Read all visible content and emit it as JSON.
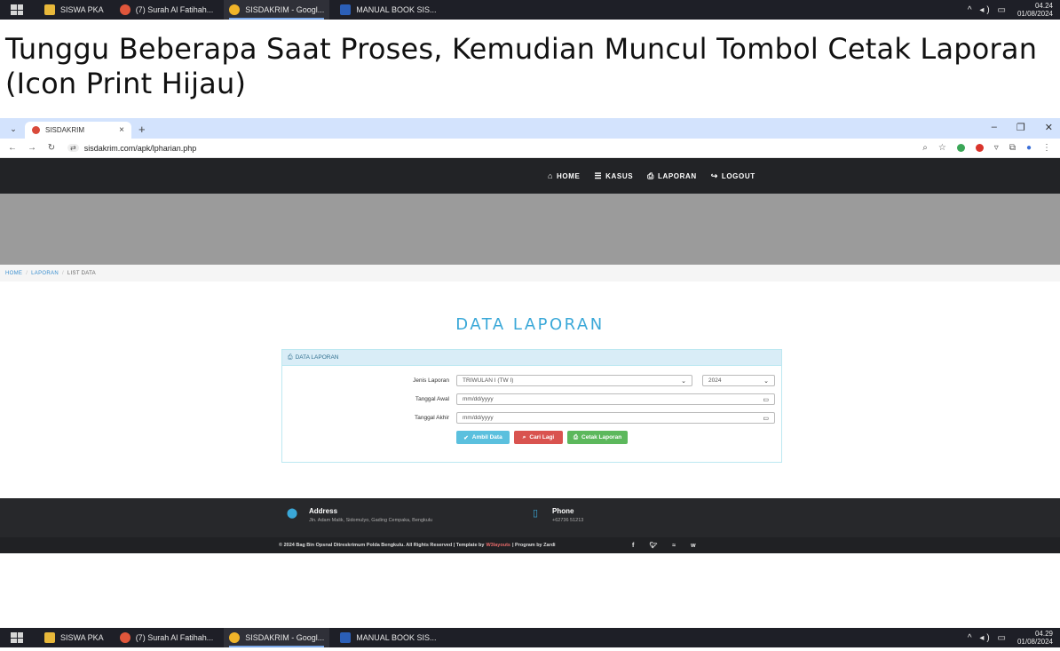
{
  "taskbar_top": {
    "items": [
      "SISWA PKA",
      "(7) Surah Al Fatihah...",
      "SISDAKRIM - Googl...",
      "MANUAL BOOK SIS..."
    ],
    "time": "04.24",
    "date": "01/08/2024"
  },
  "taskbar_bottom": {
    "items": [
      "SISWA PKA",
      "(7) Surah Al Fatihah...",
      "SISDAKRIM - Googl...",
      "MANUAL BOOK SIS..."
    ],
    "time": "04.29",
    "date": "01/08/2024"
  },
  "heading": "Tunggu Beberapa Saat Proses, Kemudian Muncul Tombol Cetak Laporan (Icon Print Hijau)",
  "browser": {
    "tab_title": "SISDAKRIM",
    "url": "sisdakrim.com/apk/lpharian.php"
  },
  "nav": {
    "home": "HOME",
    "kasus": "KASUS",
    "laporan": "LAPORAN",
    "logout": "LOGOUT"
  },
  "breadcrumb": {
    "home": "HOME",
    "laporan": "LAPORAN",
    "current": "LIST DATA"
  },
  "page_title": "DATA LAPORAN",
  "panel": {
    "title": "DATA LAPORAN",
    "jenis_label": "Jenis Laporan",
    "jenis_value": "TRIWULAN I (TW I)",
    "tahun_value": "2024",
    "awal_label": "Tanggal Awal",
    "awal_placeholder": "mm/dd/yyyy",
    "akhir_label": "Tanggal Akhir",
    "akhir_placeholder": "mm/dd/yyyy",
    "btn_ambil": "Ambil Data",
    "btn_cari": "Cari Lagi",
    "btn_cetak": "Cetak Laporan"
  },
  "footer": {
    "address_title": "Address",
    "address_text": "Jln. Adam Malik, Sidomulyo, Gading Cempaka, Bengkulu",
    "phone_title": "Phone",
    "phone_text": "+62736 51213",
    "copyright_pre": "© 2024 Bag Bin Opsnal Ditreskrimum Polda Bengkulu. All Rights Reserved | Template by",
    "copyright_link": "W3layouts",
    "copyright_post": "| Program by Zardi"
  },
  "colors": {
    "accent": "#3aa8d8",
    "btn_blue": "#5bc0de",
    "btn_red": "#d9534f",
    "btn_green": "#5cb85c"
  }
}
